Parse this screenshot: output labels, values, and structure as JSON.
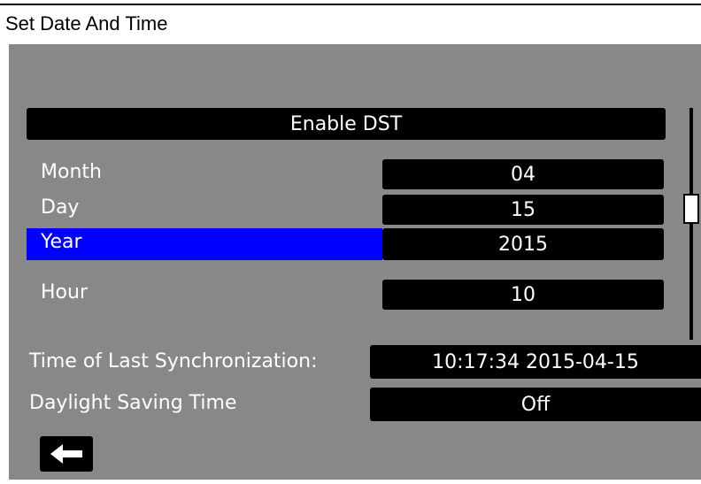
{
  "title": "Set Date And Time",
  "enable_dst_label": "Enable DST",
  "fields": [
    {
      "label": "Month",
      "value": "04"
    },
    {
      "label": "Day",
      "value": "15"
    },
    {
      "label": "Year",
      "value": "2015"
    },
    {
      "label": "Hour",
      "value": "10"
    }
  ],
  "last_sync": {
    "label": "Time of Last Synchronization:",
    "value": "10:17:34 2015-04-15"
  },
  "dst": {
    "label": "Daylight Saving Time",
    "value": "Off"
  },
  "icons": {
    "back": "back-arrow-icon"
  },
  "colors": {
    "background": "#888888",
    "field": "#000000",
    "selected": "#0000ff",
    "text": "#ffffff"
  }
}
